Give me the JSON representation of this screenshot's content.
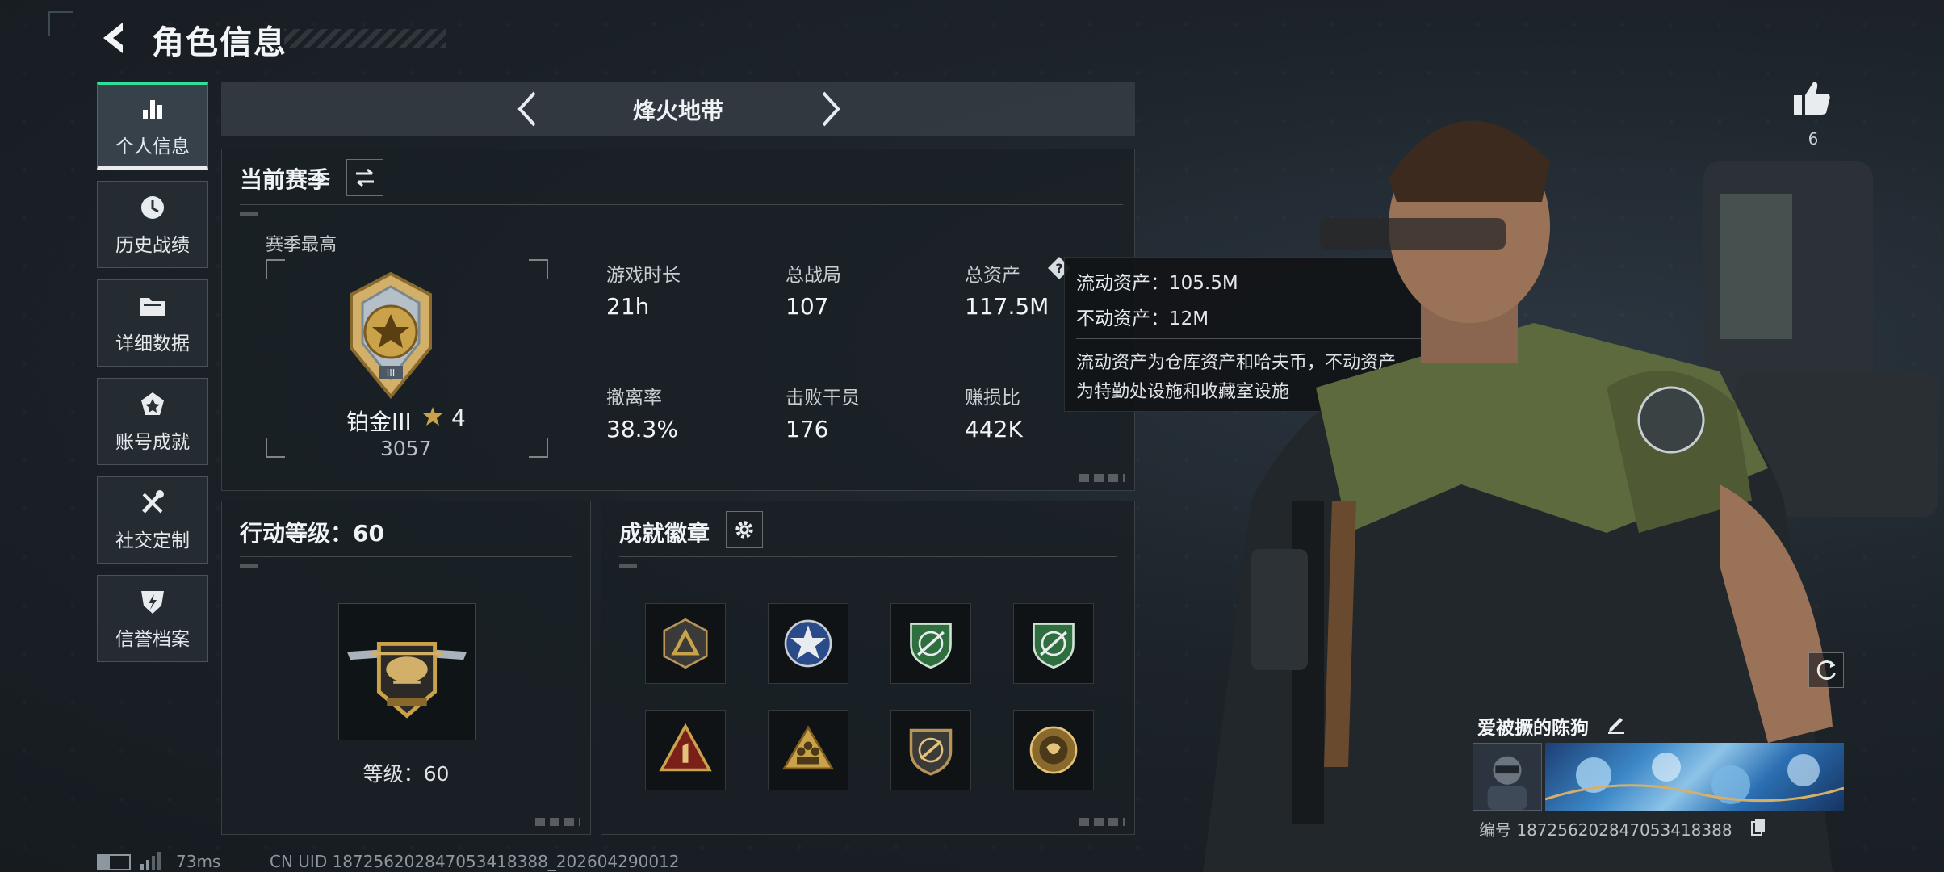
{
  "header": {
    "title": "角色信息"
  },
  "sidebar": {
    "items": [
      {
        "label": "个人信息",
        "icon": "bar-chart-icon",
        "active": true
      },
      {
        "label": "历史战绩",
        "icon": "clock-icon",
        "active": false
      },
      {
        "label": "详细数据",
        "icon": "folder-icon",
        "active": false
      },
      {
        "label": "账号成就",
        "icon": "achievement-icon",
        "active": false
      },
      {
        "label": "社交定制",
        "icon": "tools-icon",
        "active": false
      },
      {
        "label": "信誉档案",
        "icon": "shield-lightning-icon",
        "active": false
      }
    ]
  },
  "mode": {
    "title": "烽火地带"
  },
  "season": {
    "title": "当前赛季",
    "best_label": "赛季最高",
    "rank_name": "铂金III",
    "rank_stars": "4",
    "rank_score": "3057",
    "stats": [
      {
        "label": "游戏时长",
        "value": "21h"
      },
      {
        "label": "总战局",
        "value": "107"
      },
      {
        "label": "总资产",
        "value": "117.5M"
      },
      {
        "label": "撤离率",
        "value": "38.3%"
      },
      {
        "label": "击败干员",
        "value": "176"
      },
      {
        "label": "赚损比",
        "value": "442K"
      }
    ]
  },
  "tooltip": {
    "liquid": "流动资产：105.5M",
    "fixed": "不动资产：12M",
    "desc1": "流动资产为仓库资产和哈夫币，不动资产",
    "desc2": "为特勤处设施和收藏室设施"
  },
  "action_level": {
    "title": "行动等级：60",
    "level_text": "等级：60"
  },
  "badges": {
    "title": "成就徽章",
    "items": [
      "triangle-badge-icon",
      "star-badge-icon",
      "green-shield-badge-icon",
      "green-shield-badge-icon",
      "number-one-badge-icon",
      "soldiers-badge-icon",
      "knife-badge-icon",
      "gold-emblem-badge-icon"
    ]
  },
  "profile": {
    "likes": "6",
    "name": "爱被撅的陈狗",
    "code": "编号 1872562028470534183​88"
  },
  "status": {
    "ping": "73ms",
    "uid": "CN UID 187256202847053418388_202604290012"
  },
  "colors": {
    "accent": "#2ee09a",
    "gold": "#c9a24a"
  }
}
